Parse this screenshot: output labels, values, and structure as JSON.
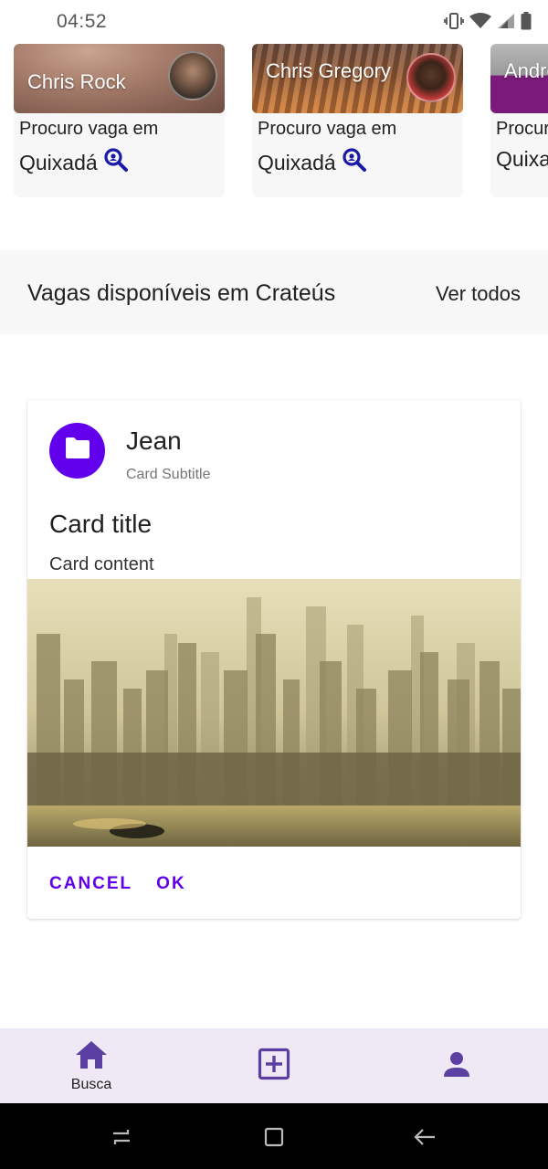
{
  "status_bar": {
    "time": "04:52",
    "icons": [
      "vibrate-icon",
      "wifi-icon",
      "signal-icon",
      "battery-icon"
    ]
  },
  "carousel": {
    "cards": [
      {
        "name": "Chris Rock",
        "line1": "Procuro vaga em",
        "city": "Quixadá",
        "icon": "search-location-icon"
      },
      {
        "name": "Chris Gregory",
        "line1": "Procuro vaga em",
        "city": "Quixadá",
        "icon": "search-location-icon"
      },
      {
        "name": "Andre Teixeira",
        "line1": "Procuro vaga em",
        "city": "Quixadá",
        "icon": "search-location-icon"
      }
    ]
  },
  "section": {
    "title": "Vagas disponíveis em Crateús",
    "link": "Ver todos"
  },
  "job_card": {
    "header_title": "Jean",
    "header_subtitle": "Card Subtitle",
    "title": "Card title",
    "content": "Card content",
    "avatar_icon": "folder-icon",
    "actions": {
      "cancel": "CANCEL",
      "ok": "OK"
    }
  },
  "bottom_nav": {
    "items": [
      {
        "label": "Busca",
        "icon": "home-icon"
      },
      {
        "label": "",
        "icon": "add-box-icon"
      },
      {
        "label": "",
        "icon": "person-icon"
      }
    ]
  },
  "colors": {
    "primary": "#6200ee",
    "nav_icon": "#5c3fa3",
    "nav_background": "#efe9f5",
    "search_icon": "#1a1aa8",
    "third_card_accent": "#7a1a7a"
  }
}
